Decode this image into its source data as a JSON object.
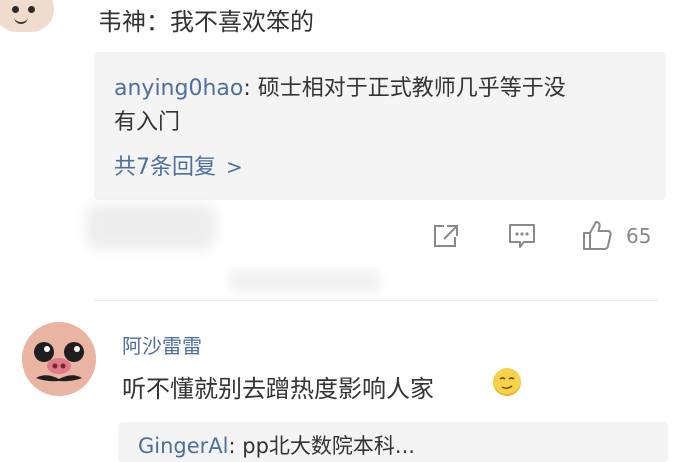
{
  "top_comment": {
    "text": "韦神：我不喜欢笨的"
  },
  "reply_preview": {
    "username": "anying0hao",
    "separator": ":",
    "text_line1": " 硕士相对于正式教师几乎等于没",
    "text_line2": "有入门",
    "more_label": "共7条回复",
    "more_chevron": ">"
  },
  "actions": {
    "share_icon": "share-icon",
    "comment_icon": "comment-icon",
    "like_icon": "thumbs-up-icon",
    "like_count": "65"
  },
  "second_comment": {
    "username": "阿沙雷雷",
    "text": "听不懂就别去蹭热度影响人家",
    "emoji": "smirk-emoji"
  },
  "second_reply_preview": {
    "username": "GingerAl",
    "separator": ":",
    "text": " pp北大数院本科..."
  },
  "colors": {
    "link": "#4d6f9e",
    "text": "#333333",
    "muted": "#888888",
    "reply_bg": "#f4f4f4"
  }
}
